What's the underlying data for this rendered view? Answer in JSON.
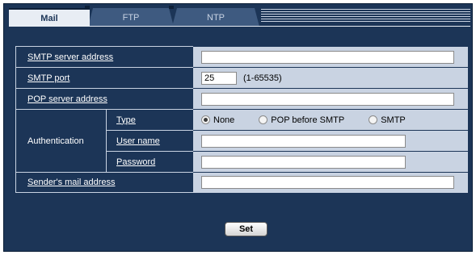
{
  "tabs": [
    {
      "label": "Mail",
      "active": true
    },
    {
      "label": "FTP",
      "active": false
    },
    {
      "label": "NTP",
      "active": false
    }
  ],
  "form": {
    "smtp_server": {
      "label": "SMTP server address",
      "value": ""
    },
    "smtp_port": {
      "label": "SMTP port",
      "value": "25",
      "range": "(1-65535)"
    },
    "pop_server": {
      "label": "POP server address",
      "value": ""
    },
    "authentication": {
      "label": "Authentication",
      "type": {
        "label": "Type",
        "options": [
          "None",
          "POP before SMTP",
          "SMTP"
        ],
        "selected": "None"
      },
      "user_name": {
        "label": "User name",
        "value": ""
      },
      "password": {
        "label": "Password",
        "value": ""
      }
    },
    "sender_mail": {
      "label": "Sender's mail address",
      "value": ""
    }
  },
  "set_button": "Set",
  "colors": {
    "panel_bg": "#1c3557",
    "value_bg": "#c9d3e2",
    "active_tab_bg": "#e8edf4"
  }
}
